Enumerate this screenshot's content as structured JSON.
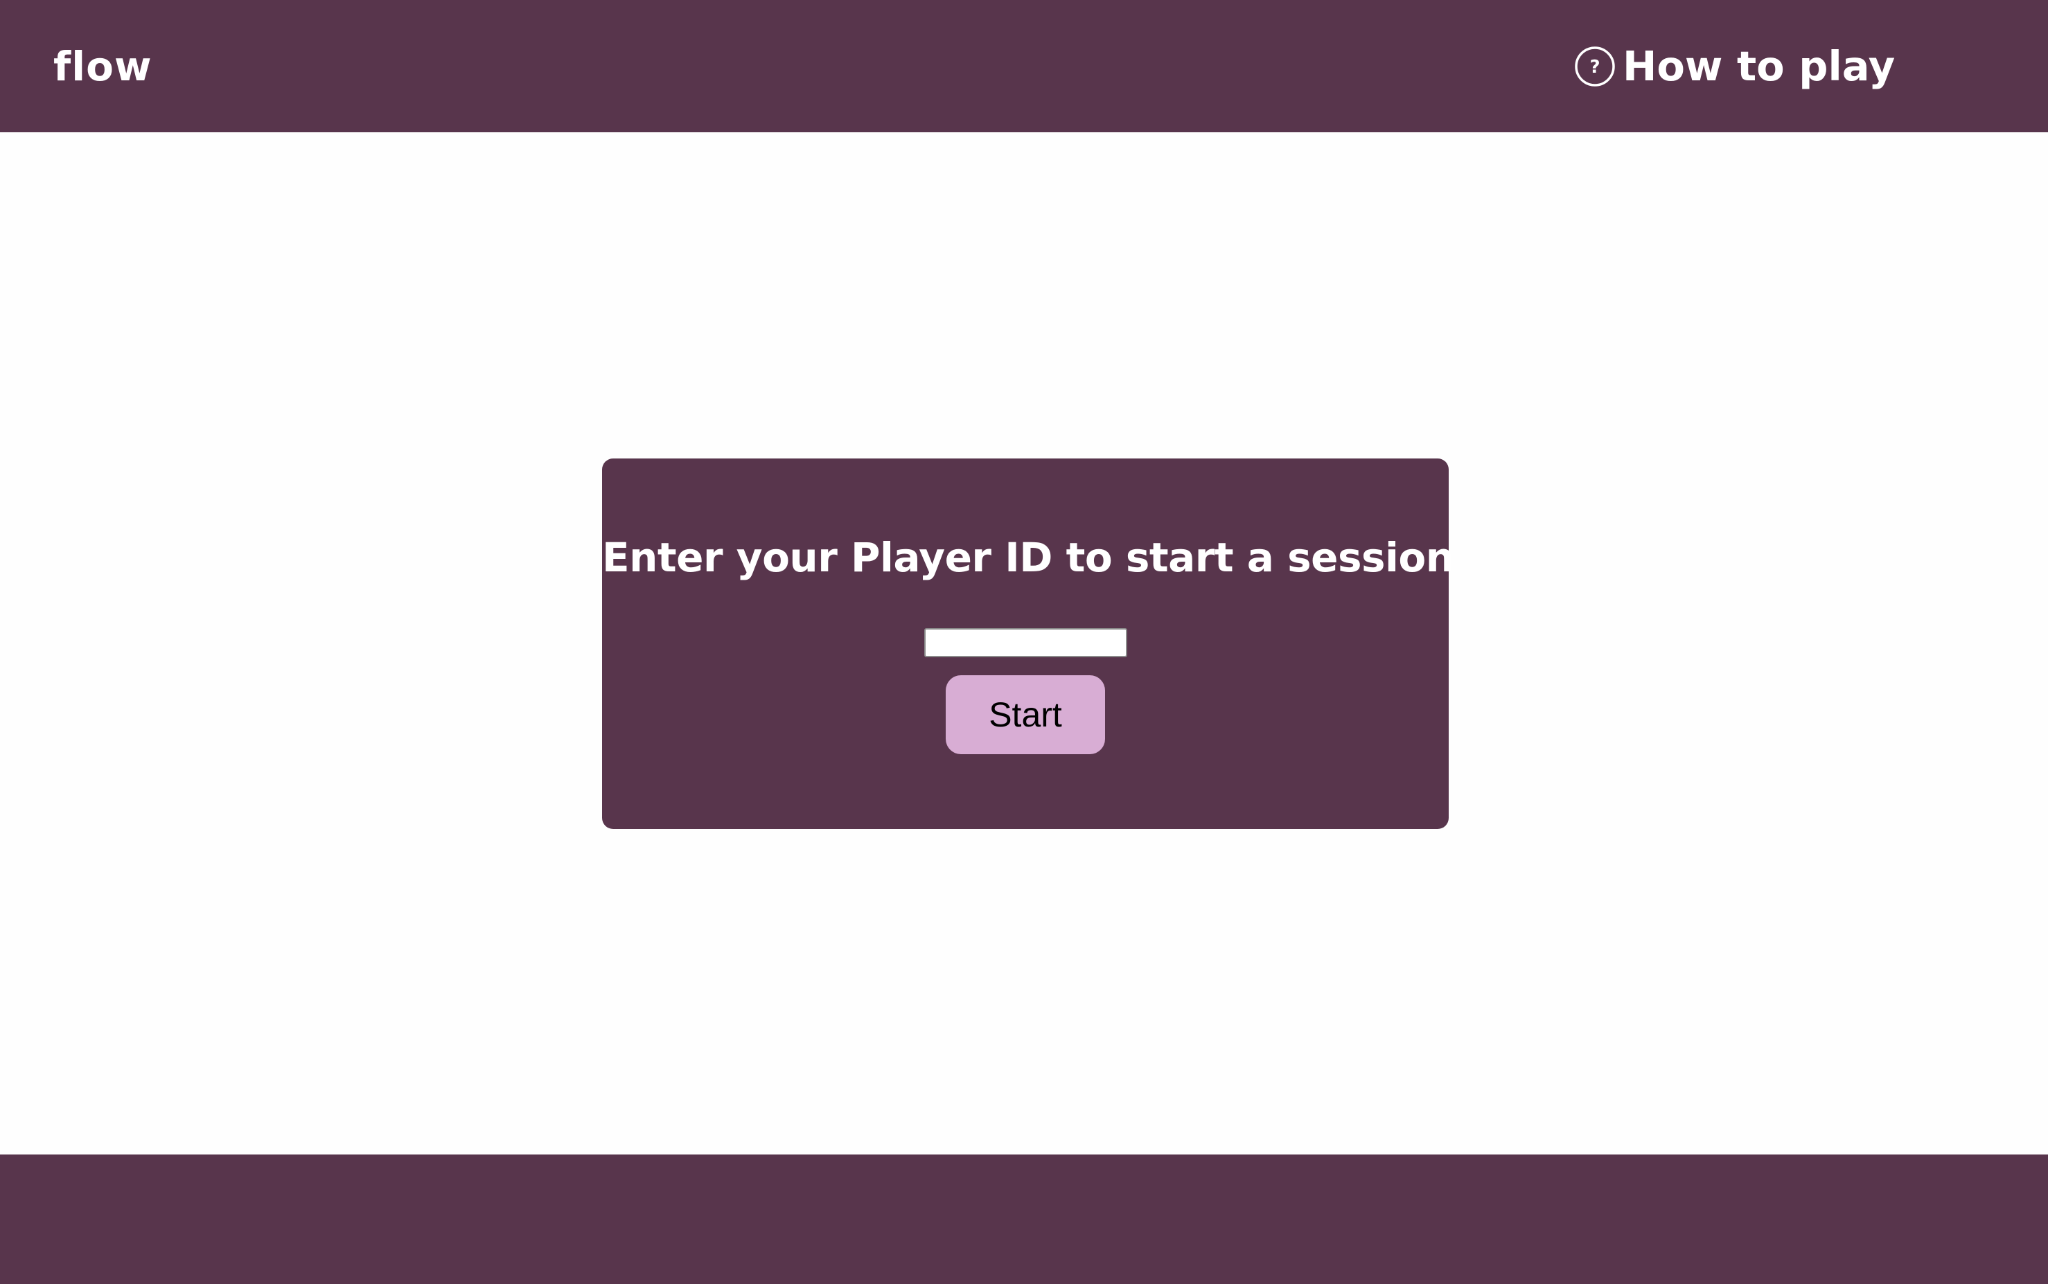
{
  "app": {
    "logo_text": "flow"
  },
  "header": {
    "help_icon": "question-circle-icon",
    "how_to_play_label": "How to play"
  },
  "session_card": {
    "title": "Enter your Player ID to start a session",
    "player_id_input": {
      "value": "",
      "placeholder": ""
    },
    "start_button_label": "Start"
  },
  "colors": {
    "brand": "#58354c",
    "button": "#d8add4",
    "background": "#fefefe",
    "text_on_brand": "#ffffff"
  }
}
